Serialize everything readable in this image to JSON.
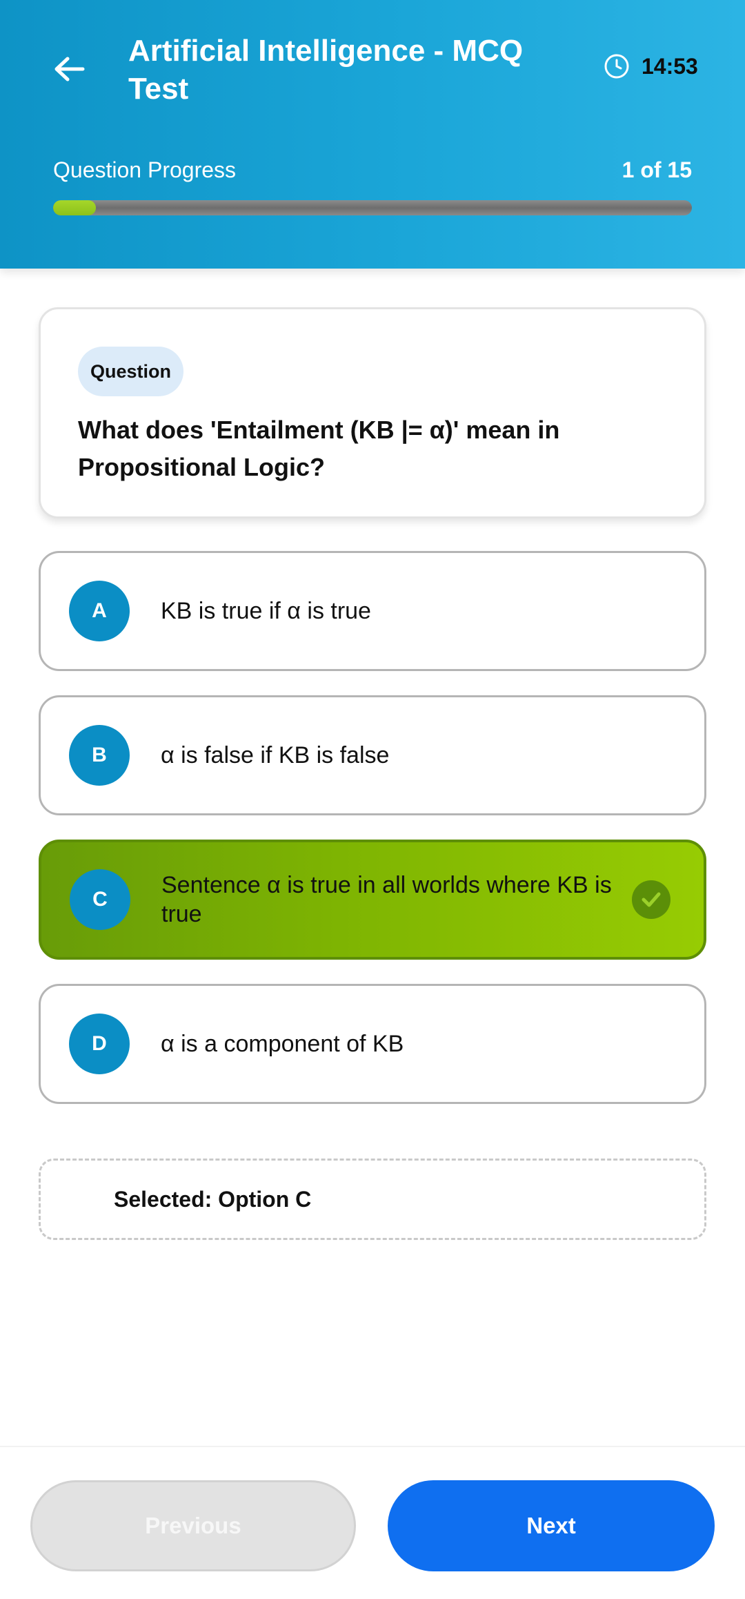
{
  "header": {
    "title": "Artificial Intelligence - MCQ Test",
    "timer": "14:53",
    "timer_icon": "clock-icon",
    "back_icon": "arrow-left-icon"
  },
  "progress": {
    "label": "Question Progress",
    "count_text": "1 of 15",
    "current": 1,
    "total": 15,
    "fill_color": "#8cc21a"
  },
  "question": {
    "badge": "Question",
    "text": "What does 'Entailment (KB |= α)' mean in Propositional Logic?"
  },
  "options": [
    {
      "letter": "A",
      "text": "KB is true if α is true",
      "selected": false
    },
    {
      "letter": "B",
      "text": "α is false if KB is false",
      "selected": false
    },
    {
      "letter": "C",
      "text": "Sentence α is true in all worlds where KB is true",
      "selected": true
    },
    {
      "letter": "D",
      "text": "α is a component of KB",
      "selected": false
    }
  ],
  "selection": {
    "text": "Selected: Option C"
  },
  "footer": {
    "previous_label": "Previous",
    "next_label": "Next"
  },
  "colors": {
    "header_accent": "#1ba6d8",
    "option_letter_bg": "#0b8ec5",
    "selected_option_bg": "#7eb402",
    "next_button": "#0f6ff0",
    "previous_button_disabled": "#e2e2e2"
  }
}
